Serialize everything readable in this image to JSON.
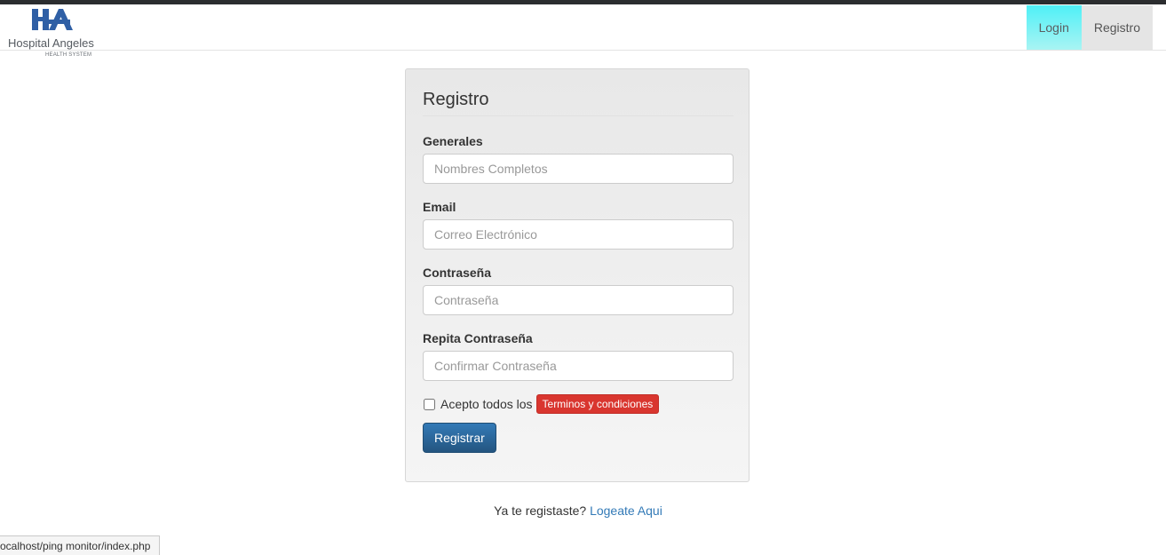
{
  "header": {
    "logo": {
      "name": "Hospital Angeles",
      "subtitle": "HEALTH SYSTEM",
      "monogram": "HA"
    },
    "nav": {
      "login_label": "Login",
      "registro_label": "Registro"
    }
  },
  "form": {
    "title": "Registro",
    "fields": [
      {
        "label": "Generales",
        "placeholder": "Nombres Completos"
      },
      {
        "label": "Email",
        "placeholder": "Correo Electrónico"
      },
      {
        "label": "Contraseña",
        "placeholder": "Contraseña"
      },
      {
        "label": "Repita Contraseña",
        "placeholder": "Confirmar Contraseña"
      }
    ],
    "terms_text": "Acepto todos los",
    "terms_link": "Terminos y condiciones",
    "terms_checked": false,
    "submit_label": "Registrar"
  },
  "footer": {
    "question": "Ya te registaste?",
    "link_label": "Logeate Aqui"
  },
  "status_bar": {
    "url": "ocalhost/ping monitor/index.php"
  },
  "colors": {
    "login_active": "#4ff0f7",
    "submit": "#337ab7",
    "terms_badge": "#d9362f",
    "link": "#337ab7"
  }
}
